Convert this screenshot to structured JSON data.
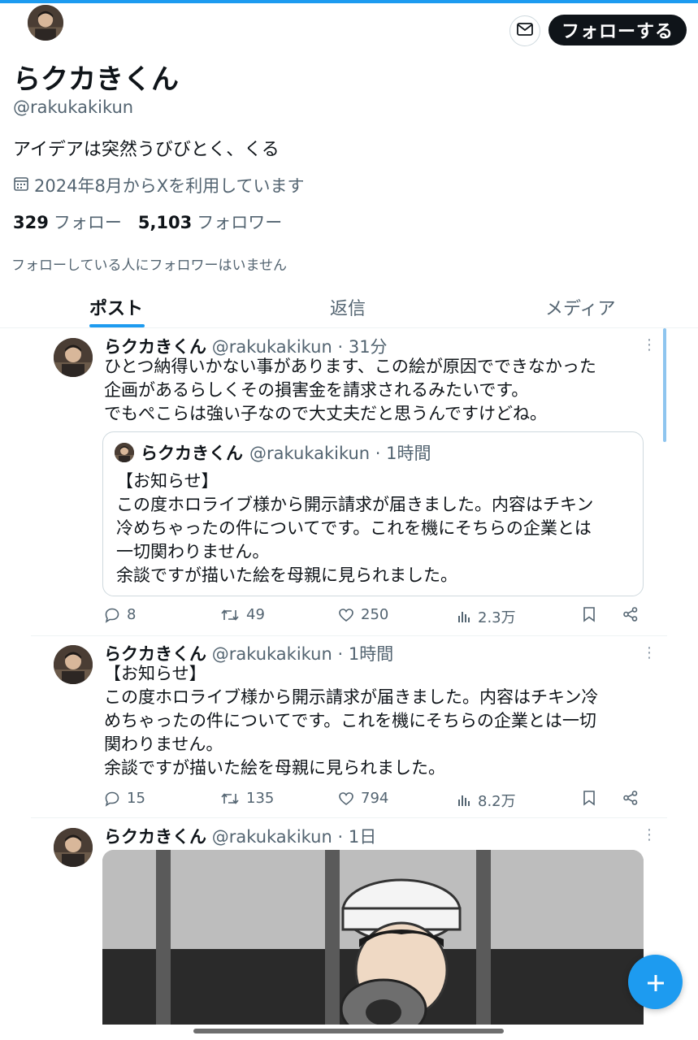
{
  "profile": {
    "name": "らクカきくん",
    "handle": "@rakukakikun",
    "bio": "アイデアは突然うびびとく、くる",
    "joined": "2024年8月からXを利用しています",
    "following_count": "329",
    "following_label": "フォロー",
    "followers_count": "5,103",
    "followers_label": "フォロワー",
    "no_common_followers": "フォローしている人にフォロワーはいません"
  },
  "header": {
    "follow_label": "フォローする"
  },
  "tabs": [
    {
      "label": "ポスト",
      "active": true
    },
    {
      "label": "返信",
      "active": false
    },
    {
      "label": "メディア",
      "active": false
    }
  ],
  "posts": [
    {
      "name": "らクカきくん",
      "meta": "@rakukakikun · 31分",
      "body": "ひとつ納得いかない事があります、この絵が原因でできなかった\n企画があるらしくその損害金を請求されるみたいです。\nでもぺこらは強い子なので大丈夫だと思うんですけどね。",
      "quote": {
        "name": "らクカきくん",
        "meta": "@rakukakikun · 1時間",
        "body": "【お知らせ】\nこの度ホロライブ様から開示請求が届きました。内容はチキン\n冷めちゃったの件についてです。これを機にそちらの企業とは\n一切関わりません。\n余談ですが描いた絵を母親に見られました。"
      },
      "replies": "8",
      "reposts": "49",
      "likes": "250",
      "views": "2.3万"
    },
    {
      "name": "らクカきくん",
      "meta": "@rakukakikun · 1時間",
      "body": "【お知らせ】\nこの度ホロライブ様から開示請求が届きました。内容はチキン冷\nめちゃったの件についてです。これを機にそちらの企業とは一切\n関わりません。\n余談ですが描いた絵を母親に見られました。",
      "replies": "15",
      "reposts": "135",
      "likes": "794",
      "views": "8.2万"
    },
    {
      "name": "らクカきくん",
      "meta": "@rakukakikun · 1日"
    }
  ],
  "icons": {
    "mail": "mail-icon",
    "calendar": "calendar-icon",
    "reply": "reply-icon",
    "repost": "repost-icon",
    "like": "like-icon",
    "views": "views-icon",
    "bookmark": "bookmark-icon",
    "share": "share-icon",
    "compose": "plus-icon"
  },
  "colors": {
    "accent": "#1d9bf0",
    "text": "#0f1419",
    "secondary": "#536471"
  }
}
